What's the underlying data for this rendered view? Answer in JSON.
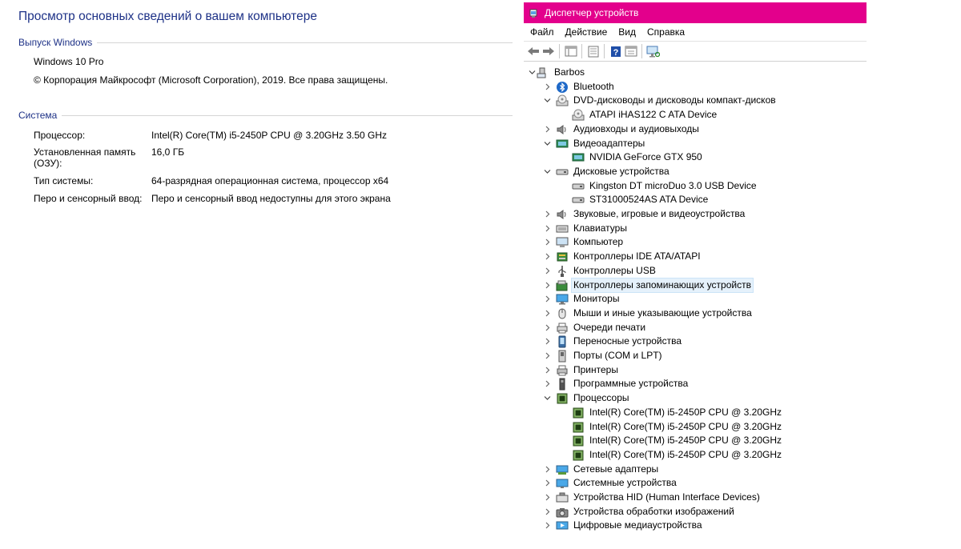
{
  "system": {
    "title": "Просмотр основных сведений о вашем компьютере",
    "edition_section": "Выпуск Windows",
    "edition": "Windows 10 Pro",
    "copyright": "© Корпорация Майкрософт (Microsoft Corporation), 2019. Все права защищены.",
    "system_section": "Система",
    "rows": [
      {
        "label": "Процессор:",
        "value": "Intel(R) Core(TM) i5-2450P CPU @ 3.20GHz   3.50 GHz"
      },
      {
        "label": "Установленная память (ОЗУ):",
        "value": "16,0 ГБ"
      },
      {
        "label": "Тип системы:",
        "value": "64-разрядная операционная система, процессор x64"
      },
      {
        "label": "Перо и сенсорный ввод:",
        "value": "Перо и сенсорный ввод недоступны для этого экрана"
      }
    ]
  },
  "device_manager": {
    "title": "Диспетчер устройств",
    "title_bar_color": "#e3008c",
    "menu": [
      "Файл",
      "Действие",
      "Вид",
      "Справка"
    ],
    "toolbar": [
      "back-arrow-icon",
      "forward-arrow-icon",
      "console-tree-icon",
      "properties-icon",
      "help-icon",
      "view-icon",
      "scan-hardware-icon"
    ],
    "root": "Barbos",
    "tree": [
      {
        "label": "Bluetooth",
        "icon": "bluetooth-icon",
        "level": 1,
        "state": "collapsed"
      },
      {
        "label": "DVD-дисководы и дисководы компакт-дисков",
        "icon": "dvd-drive-icon",
        "level": 1,
        "state": "expanded"
      },
      {
        "label": "ATAPI iHAS122   C ATA Device",
        "icon": "dvd-drive-icon",
        "level": 2,
        "state": "leaf"
      },
      {
        "label": "Аудиовходы и аудиовыходы",
        "icon": "speaker-icon",
        "level": 1,
        "state": "collapsed"
      },
      {
        "label": "Видеоадаптеры",
        "icon": "display-adapter-icon",
        "level": 1,
        "state": "expanded"
      },
      {
        "label": "NVIDIA GeForce GTX 950",
        "icon": "display-adapter-icon",
        "level": 2,
        "state": "leaf"
      },
      {
        "label": "Дисковые устройства",
        "icon": "disk-drive-icon",
        "level": 1,
        "state": "expanded"
      },
      {
        "label": "Kingston DT microDuo 3.0 USB Device",
        "icon": "disk-drive-icon",
        "level": 2,
        "state": "leaf"
      },
      {
        "label": "ST31000524AS ATA Device",
        "icon": "disk-drive-icon",
        "level": 2,
        "state": "leaf"
      },
      {
        "label": "Звуковые, игровые и видеоустройства",
        "icon": "speaker-icon",
        "level": 1,
        "state": "collapsed"
      },
      {
        "label": "Клавиатуры",
        "icon": "keyboard-icon",
        "level": 1,
        "state": "collapsed"
      },
      {
        "label": "Компьютер",
        "icon": "computer-icon",
        "level": 1,
        "state": "collapsed"
      },
      {
        "label": "Контроллеры IDE ATA/ATAPI",
        "icon": "ide-controller-icon",
        "level": 1,
        "state": "collapsed"
      },
      {
        "label": "Контроллеры USB",
        "icon": "usb-icon",
        "level": 1,
        "state": "collapsed"
      },
      {
        "label": "Контроллеры запоминающих устройств",
        "icon": "storage-controller-icon",
        "level": 1,
        "state": "collapsed",
        "selected": true
      },
      {
        "label": "Мониторы",
        "icon": "monitor-icon",
        "level": 1,
        "state": "collapsed"
      },
      {
        "label": "Мыши и иные указывающие устройства",
        "icon": "mouse-icon",
        "level": 1,
        "state": "collapsed"
      },
      {
        "label": "Очереди печати",
        "icon": "print-queue-icon",
        "level": 1,
        "state": "collapsed"
      },
      {
        "label": "Переносные устройства",
        "icon": "portable-device-icon",
        "level": 1,
        "state": "collapsed"
      },
      {
        "label": "Порты (COM и LPT)",
        "icon": "port-icon",
        "level": 1,
        "state": "collapsed"
      },
      {
        "label": "Принтеры",
        "icon": "printer-icon",
        "level": 1,
        "state": "collapsed"
      },
      {
        "label": "Программные устройства",
        "icon": "software-device-icon",
        "level": 1,
        "state": "collapsed"
      },
      {
        "label": "Процессоры",
        "icon": "processor-icon",
        "level": 1,
        "state": "expanded"
      },
      {
        "label": "Intel(R) Core(TM) i5-2450P CPU @ 3.20GHz",
        "icon": "processor-icon",
        "level": 2,
        "state": "leaf"
      },
      {
        "label": "Intel(R) Core(TM) i5-2450P CPU @ 3.20GHz",
        "icon": "processor-icon",
        "level": 2,
        "state": "leaf"
      },
      {
        "label": "Intel(R) Core(TM) i5-2450P CPU @ 3.20GHz",
        "icon": "processor-icon",
        "level": 2,
        "state": "leaf"
      },
      {
        "label": "Intel(R) Core(TM) i5-2450P CPU @ 3.20GHz",
        "icon": "processor-icon",
        "level": 2,
        "state": "leaf"
      },
      {
        "label": "Сетевые адаптеры",
        "icon": "network-adapter-icon",
        "level": 1,
        "state": "collapsed"
      },
      {
        "label": "Системные устройства",
        "icon": "system-device-icon",
        "level": 1,
        "state": "collapsed"
      },
      {
        "label": "Устройства HID (Human Interface Devices)",
        "icon": "hid-icon",
        "level": 1,
        "state": "collapsed"
      },
      {
        "label": "Устройства обработки изображений",
        "icon": "camera-icon",
        "level": 1,
        "state": "collapsed"
      },
      {
        "label": "Цифровые медиаустройства",
        "icon": "media-device-icon",
        "level": 1,
        "state": "collapsed"
      }
    ]
  }
}
